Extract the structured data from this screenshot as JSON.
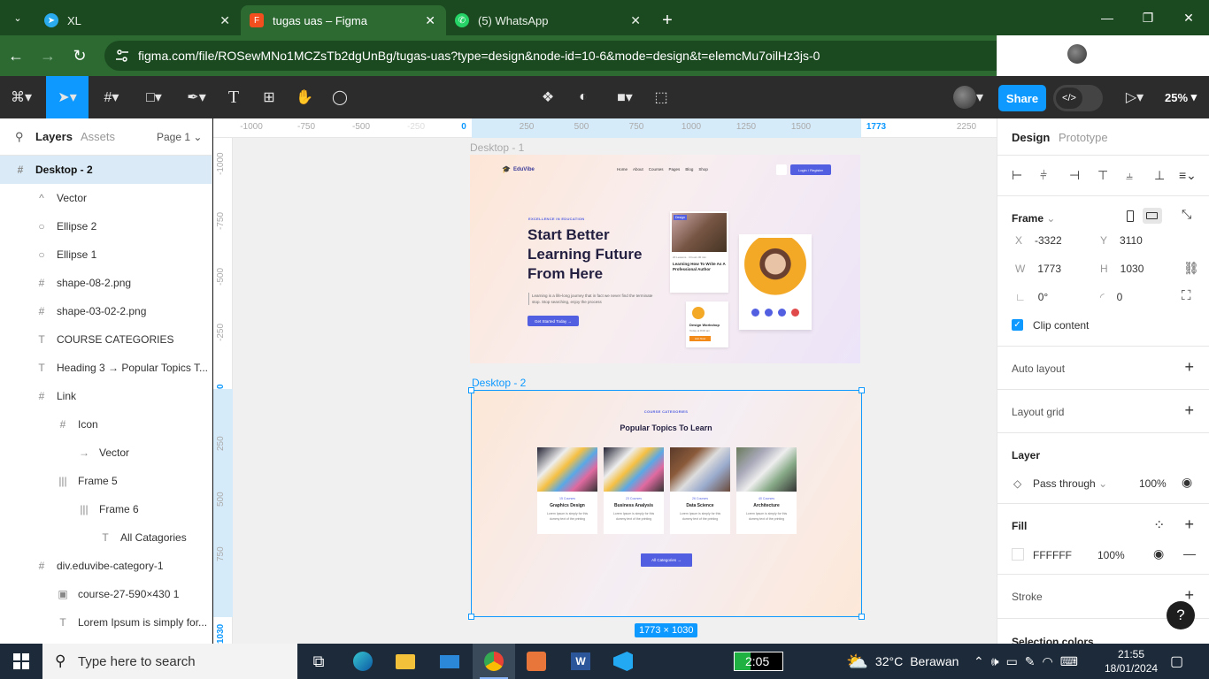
{
  "browser": {
    "tabs": [
      {
        "title": "XL",
        "icon": "telegram-icon",
        "color": "#2aabee"
      },
      {
        "title": "tugas uas – Figma",
        "icon": "figma-icon",
        "color": "#f24e1e"
      },
      {
        "title": "(5) WhatsApp",
        "icon": "whatsapp-icon",
        "color": "#25d366"
      }
    ],
    "new_tab": "+",
    "url": "figma.com/file/ROSewMNo1MCZsTb2dgUnBg/tugas-uas?type=design&node-id=10-6&mode=design&t=elemcMu7oilHz3js-0"
  },
  "figma_toolbar": {
    "share_label": "Share",
    "zoom": "25%"
  },
  "layers_panel": {
    "tab_layers": "Layers",
    "tab_assets": "Assets",
    "page": "Page 1",
    "items": [
      {
        "name": "Desktop - 2",
        "icon": "#",
        "indent": 0
      },
      {
        "name": "Vector",
        "icon": "^",
        "indent": 1
      },
      {
        "name": "Ellipse 2",
        "icon": "○",
        "indent": 1
      },
      {
        "name": "Ellipse 1",
        "icon": "○",
        "indent": 1
      },
      {
        "name": "shape-08-2.png",
        "icon": "#",
        "indent": 1
      },
      {
        "name": "shape-03-02-2.png",
        "icon": "#",
        "indent": 1
      },
      {
        "name": "COURSE CATEGORIES",
        "icon": "T",
        "indent": 1
      },
      {
        "name": "Heading 3 → Popular Topics T...",
        "icon": "T",
        "indent": 1
      },
      {
        "name": "Link",
        "icon": "#",
        "indent": 1
      },
      {
        "name": "Icon",
        "icon": "#",
        "indent": 2
      },
      {
        "name": "Vector",
        "icon": "→",
        "indent": 3
      },
      {
        "name": "Frame 5",
        "icon": "|||",
        "indent": 2
      },
      {
        "name": "Frame 6",
        "icon": "|||",
        "indent": 3
      },
      {
        "name": "All Catagories",
        "icon": "T",
        "indent": 4
      },
      {
        "name": "div.eduvibe-category-1",
        "icon": "#",
        "indent": 1
      },
      {
        "name": "course-27-590×430 1",
        "icon": "▣",
        "indent": 2
      },
      {
        "name": "Lorem Ipsum is simply for...",
        "icon": "T",
        "indent": 2
      }
    ]
  },
  "rulers": {
    "horizontal": [
      "-1000",
      "-750",
      "-500",
      "-250",
      "0",
      "250",
      "500",
      "750",
      "1000",
      "1250",
      "1500",
      "1773",
      "2250"
    ],
    "vertical": [
      "-1000",
      "-750",
      "-500",
      "-250",
      "0",
      "250",
      "500",
      "750",
      "1030"
    ]
  },
  "canvas": {
    "frame1_label": "Desktop - 1",
    "frame2_label": "Desktop - 2",
    "selection_size": "1773 × 1030",
    "frame1": {
      "logo": "EduVibe",
      "menu": [
        "Home",
        "About",
        "Courses",
        "Pages",
        "Blog",
        "Shop"
      ],
      "login": "Login / Register",
      "eyebrow": "EXCELLENCE IN EDUCATION",
      "headline": "Start Better Learning Future From Here",
      "paragraph": "Learning is a life-long journey that in fact we never find the terminate stop. Stop searching, enjoy the process",
      "cta": "Get Started Today →",
      "card1_tag": "Design",
      "card1_meta": "20 Lessons · 3 hours 30 min",
      "card1_title": "Learning How To Write As A Professional Author",
      "card3_title": "Design Workshop",
      "card3_date": "Today at 8:00 am",
      "card3_btn": "Join Now"
    },
    "frame2": {
      "eyebrow": "COURSE CATEGORIES",
      "heading": "Popular Topics To Learn",
      "cards": [
        {
          "count": "15 Courses",
          "name": "Graphics Design",
          "text": "Lorem Ipsum is simply for this dummy text of the printing"
        },
        {
          "count": "23 Courses",
          "name": "Business Analysis",
          "text": "Lorem Ipsum is simply for this dummy text of the printing"
        },
        {
          "count": "26 Courses",
          "name": "Data Science",
          "text": "Lorem Ipsum is simply for this dummy text of the printing"
        },
        {
          "count": "40 Courses",
          "name": "Architecture",
          "text": "Lorem Ipsum is simply for this dummy text of the printing"
        }
      ],
      "button": "All Categories →"
    }
  },
  "design_panel": {
    "tab_design": "Design",
    "tab_prototype": "Prototype",
    "frame_label": "Frame",
    "x": "-3322",
    "y": "3110",
    "w": "1773",
    "h": "1030",
    "rotation": "0°",
    "radius": "0",
    "clip_content": "Clip content",
    "auto_layout": "Auto layout",
    "layout_grid": "Layout grid",
    "layer": "Layer",
    "blend": "Pass through",
    "opacity": "100%",
    "fill": "Fill",
    "fill_hex": "FFFFFF",
    "fill_opacity": "100%",
    "stroke": "Stroke",
    "selection_colors": "Selection colors"
  },
  "taskbar": {
    "search_placeholder": "Type here to search",
    "battery": "2:05",
    "temperature": "32°C",
    "weather": "Berawan",
    "time": "21:55",
    "date": "18/01/2024"
  }
}
